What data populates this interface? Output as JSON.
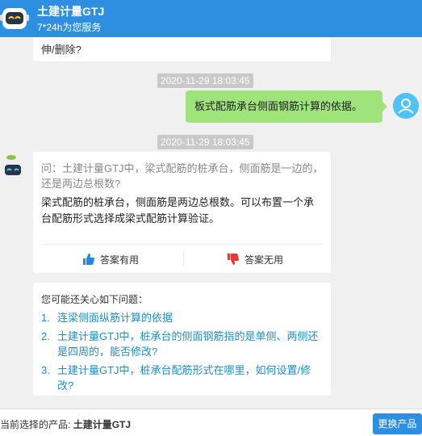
{
  "header": {
    "title": "土建计量GTJ",
    "subtitle": "7*24h为您服务"
  },
  "chat": {
    "prev_tail": "伸/删除?",
    "timestamp1": "2020-11-29 18:03:45",
    "user_message": "板式配筋承台侧面钢筋计算的依据。",
    "timestamp2": "2020-11-29 18:03:45",
    "answer": {
      "question": "问：土建计量GTJ中，梁式配筋的桩承台，侧面筋是一边的，还是两边总根数?",
      "body": "梁式配筋的桩承台，侧面筋是两边总根数。可以布置一个承台配筋形式选择成梁式配筋计算验证。",
      "useful_label": "答案有用",
      "useless_label": "答案无用"
    },
    "related": {
      "title": "您可能还关心如下问题：",
      "items": [
        {
          "num": "1.",
          "label": "连梁侧面纵筋计算的依据"
        },
        {
          "num": "2.",
          "label": "土建计量GTJ中，桩承台的侧面钢筋指的是单侧、两侧还是四周的，能否修改?"
        },
        {
          "num": "3.",
          "label": "土建计量GTJ中，桩承台配筋形式在哪里，如何设置/修改?"
        }
      ]
    }
  },
  "footer": {
    "current_label": "当前选择的产品:",
    "current_product": "土建计量GTJ",
    "switch_label": "更换产品"
  },
  "colors": {
    "header_bg": "#2e8fe0",
    "user_bubble": "#9ee47a",
    "link": "#1a8fc9"
  }
}
